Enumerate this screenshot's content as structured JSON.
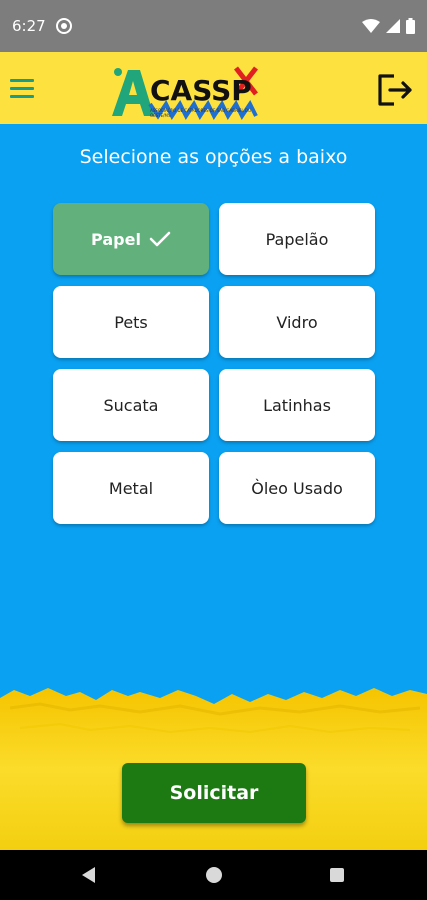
{
  "status_bar": {
    "time": "6:27"
  },
  "app_bar": {
    "logo_text": "CASSP",
    "logo_letter": "A",
    "logo_subtitle": "ASSOCIAÇÃO DE CATADORES DE SÃO GABRIEL DO OESTE/MS"
  },
  "heading": "Selecione as opções a baixo",
  "options": [
    {
      "label": "Papel",
      "selected": true
    },
    {
      "label": "Papelão",
      "selected": false
    },
    {
      "label": "Pets",
      "selected": false
    },
    {
      "label": "Vidro",
      "selected": false
    },
    {
      "label": "Sucata",
      "selected": false
    },
    {
      "label": "Latinhas",
      "selected": false
    },
    {
      "label": "Metal",
      "selected": false
    },
    {
      "label": "Òleo Usado",
      "selected": false
    }
  ],
  "action": {
    "solicitar_label": "Solicitar"
  },
  "colors": {
    "background_blue": "#0aa1f2",
    "app_bar_yellow": "#fde23f",
    "selected_green": "#62b07c",
    "button_green": "#1d7a13",
    "menu_teal": "#1a9c8c"
  },
  "icons": {
    "menu": "hamburger-menu-icon",
    "logout": "logout-icon",
    "check": "check-icon"
  }
}
